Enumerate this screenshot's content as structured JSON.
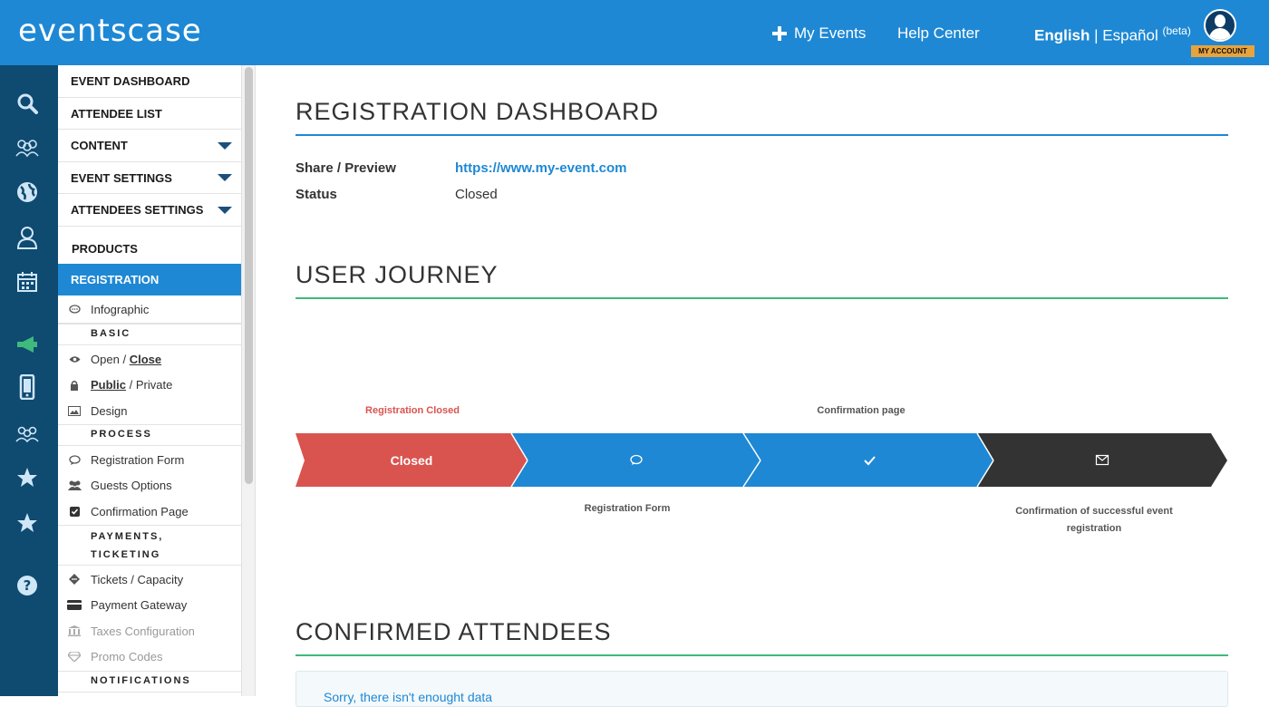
{
  "header": {
    "logo": "eventscase",
    "my_events": "My Events",
    "help_center": "Help Center",
    "lang_english": "English",
    "lang_separator": "|",
    "lang_spanish": "Español",
    "lang_beta": "(beta)",
    "account_label": "MY ACCOUNT"
  },
  "rail": {
    "icons": [
      "search-icon",
      "attendees-group-icon",
      "globe-icon",
      "user-icon",
      "calendar-icon",
      "megaphone-icon",
      "mobile-icon",
      "community-icon",
      "star-icon",
      "star-icon",
      "help-icon"
    ],
    "active_color": "#3fb97c"
  },
  "menu": {
    "event_dashboard": "EVENT DASHBOARD",
    "attendee_list": "ATTENDEE LIST",
    "content": "CONTENT",
    "event_settings": "EVENT SETTINGS",
    "attendees_settings": "ATTENDEES SETTINGS",
    "products": "PRODUCTS",
    "registration": "REGISTRATION",
    "infographic": "Infographic",
    "basic": "BASIC",
    "open": "Open",
    "slash": "/",
    "close": "Close",
    "public": "Public",
    "private": "Private",
    "design": "Design",
    "process": "PROCESS",
    "registration_form": "Registration Form",
    "guests_options": "Guests Options",
    "confirmation_page": "Confirmation Page",
    "payments_1": "PAYMENTS,",
    "payments_2": "TICKETING",
    "tickets_capacity": "Tickets / Capacity",
    "payment_gateway": "Payment Gateway",
    "taxes_configuration": "Taxes Configuration",
    "promo_codes": "Promo Codes",
    "notifications": "NOTIFICATIONS"
  },
  "main": {
    "title": "REGISTRATION DASHBOARD",
    "share_label": "Share / Preview",
    "share_url": "https://www.my-event.com",
    "status_label": "Status",
    "status_value": "Closed",
    "journey_title": "USER JOURNEY",
    "journey": {
      "top_labels": [
        "Registration Closed",
        "Confirmation page"
      ],
      "bottom_labels": [
        "Registration Form",
        "Confirmation of successful event",
        "registration"
      ],
      "steps": [
        {
          "label": "Closed",
          "color": "#d9534f",
          "icon": "closed-text"
        },
        {
          "label": "",
          "color": "#1e88d4",
          "icon": "comment-icon"
        },
        {
          "label": "",
          "color": "#1e88d4",
          "icon": "check-icon"
        },
        {
          "label": "",
          "color": "#333333",
          "icon": "envelope-icon"
        }
      ]
    },
    "confirmed_title": "CONFIRMED ATTENDEES",
    "alert_text": "Sorry, there isn't enought data"
  },
  "colors": {
    "brand": "#1e88d4",
    "rail": "#0f4a70",
    "rule_blue": "#1e88d4",
    "rule_green": "#3fb97c",
    "closed_red": "#d9534f",
    "dark_step": "#333333"
  }
}
